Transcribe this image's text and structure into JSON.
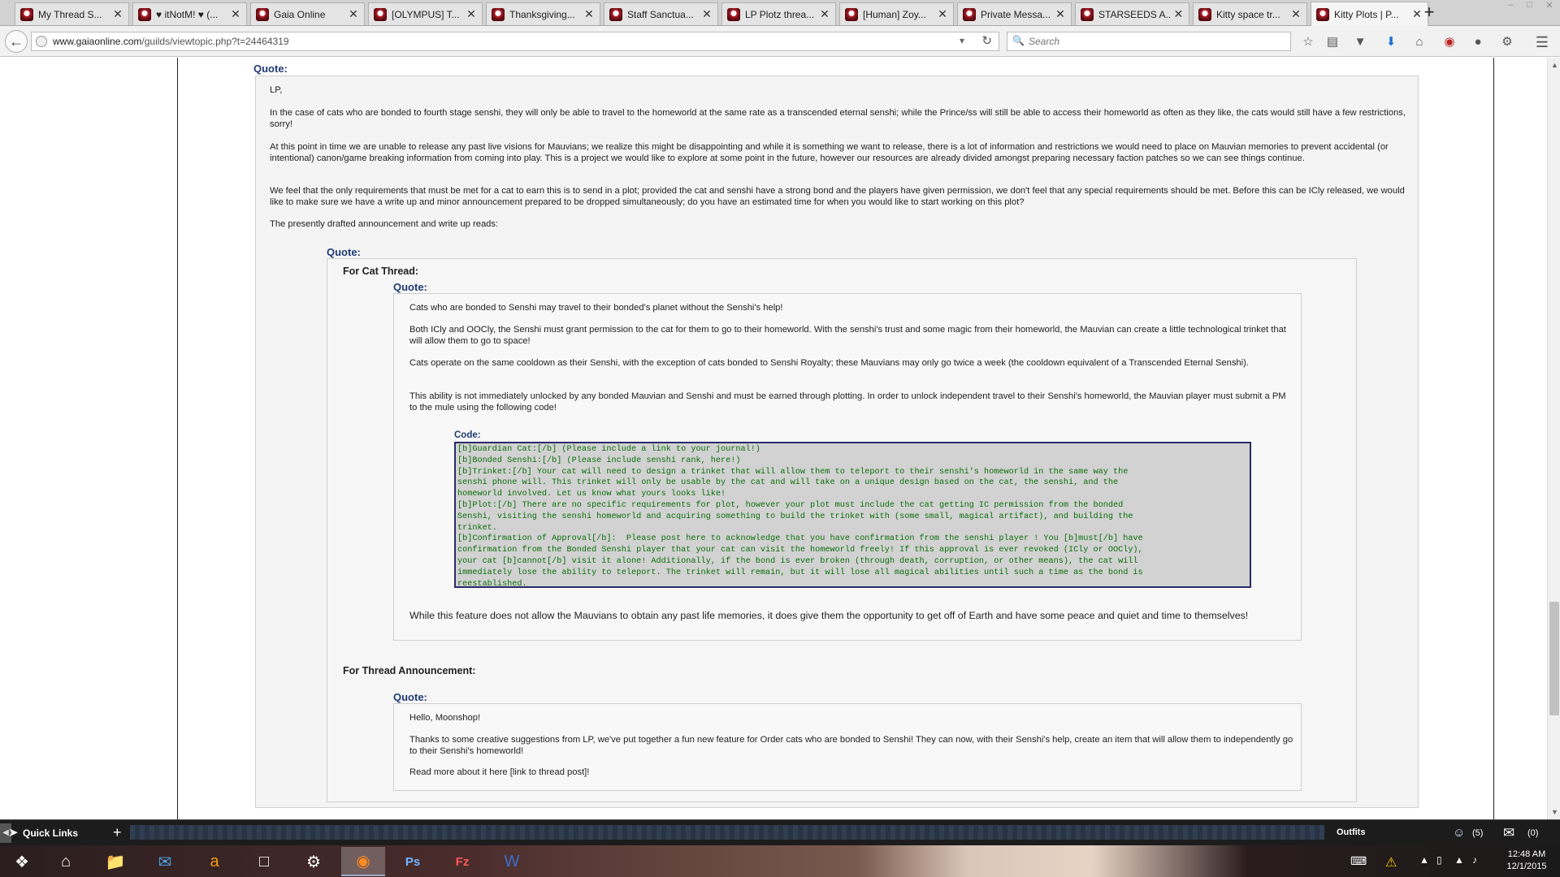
{
  "browser": {
    "tabs": [
      {
        "label": "My Thread S...",
        "active": false
      },
      {
        "label": "♥ itNotM! ♥ (...",
        "active": false
      },
      {
        "label": "Gaia Online",
        "active": false
      },
      {
        "label": "[OLYMPUS] T...",
        "active": false
      },
      {
        "label": "Thanksgiving...",
        "active": false
      },
      {
        "label": "Staff Sanctua...",
        "active": false
      },
      {
        "label": "LP Plotz threa...",
        "active": false
      },
      {
        "label": "[Human] Zoy...",
        "active": false
      },
      {
        "label": "Private Messa...",
        "active": false
      },
      {
        "label": "STARSEEDS A...",
        "active": false
      },
      {
        "label": "Kitty space tr...",
        "active": false
      },
      {
        "label": "Kitty Plots | P...",
        "active": true
      }
    ],
    "url_domain": "www.gaiaonline.com",
    "url_path": "/guilds/viewtopic.php?t=24464319",
    "search_placeholder": "Search"
  },
  "post": {
    "quote_label": "Quote:",
    "outer_paragraphs": [
      "LP,",
      "In the case of cats who are bonded to fourth stage senshi, they will only be able to travel to the homeworld at the same rate as a transcended eternal senshi; while the Prince/ss will still be able to access their homeworld as often as they like, the cats would still have a few restrictions, sorry!",
      "At this point in time we are unable to release any past live visions for Mauvians; we realize this might be disappointing and while it is something we want to release, there is a lot of information and restrictions we would need to place on Mauvian memories to prevent accidental (or intentional) canon/game breaking information from coming into play. This is a project we would like to explore at some point in the future, however our resources are already divided amongst preparing necessary faction patches so we can see things continue.",
      "We feel that the only requirements that must be met for a cat to earn this is to send in a plot; provided the cat and senshi have a strong bond and the players have given permission, we don't feel that any special requirements should be met. Before this can be ICly released, we would like to make sure we have a write up and minor announcement prepared to be dropped simultaneously; do you have an estimated time for when you would like to start working on this plot?",
      "The presently drafted announcement and write up reads:"
    ],
    "cat_thread_heading": "For Cat Thread:",
    "cat_thread_paragraphs": [
      "Cats who are bonded to Senshi may travel to their bonded's planet without the Senshi's help!",
      "Both ICly and OOCly, the Senshi must grant permission to the cat for them to go to their homeworld. With the senshi's trust and some magic from their homeworld, the Mauvian can create a little technological trinket that will allow them to go to space!",
      "Cats operate on the same cooldown as their Senshi, with the exception of cats bonded to Senshi Royalty; these Mauvians may only go twice a week (the cooldown equivalent of a Transcended Eternal Senshi).",
      "This ability is not immediately unlocked by any bonded Mauvian and Senshi and must be earned through plotting. In order to unlock independent travel to their Senshi's homeworld, the Mauvian player must submit a PM to the mule using the following code!"
    ],
    "code_label": "Code:",
    "code_lines": [
      "[b]Guardian Cat:[/b] (Please include a link to your journal!)",
      "[b]Bonded Senshi:[/b] (Please include senshi rank, here!)",
      "[b]Trinket:[/b] Your cat will need to design a trinket that will allow them to teleport to their senshi's homeworld in the same way the",
      "senshi phone will. This trinket will only be usable by the cat and will take on a unique design based on the cat, the senshi, and the",
      "homeworld involved. Let us know what yours looks like!",
      "[b]Plot:[/b] There are no specific requirements for plot, however your plot must include the cat getting IC permission from the bonded",
      "Senshi, visiting the senshi homeworld and acquiring something to build the trinket with (some small, magical artifact), and building the",
      "trinket.",
      "[b]Confirmation of Approval[/b]:  Please post here to acknowledge that you have confirmation from the senshi player ! You [b]must[/b] have",
      "confirmation from the Bonded Senshi player that your cat can visit the homeworld freely! If this approval is ever revoked (ICly or OOCly),",
      "your cat [b]cannot[/b] visit it alone! Additionally, if the bond is ever broken (through death, corruption, or other means), the cat will",
      "immediately lose the ability to teleport. The trinket will remain, but it will lose all magical abilities until such a time as the bond is",
      "reestablished."
    ],
    "cat_thread_closing": "While this feature does not allow the Mauvians to obtain any past life memories, it does give them the opportunity to get off of Earth and have some peace and quiet and time to themselves!",
    "announcement_heading": "For Thread Announcement:",
    "announcement_paragraphs": [
      "Hello, Moonshop!",
      "Thanks to some creative suggestions from LP, we've put together a fun new feature for Order cats who are bonded to Senshi! They can now, with their Senshi's help, create an item that will allow them to independently go to their Senshi's homeworld!",
      "Read more about it here [link to thread post]!"
    ]
  },
  "gaia_bar": {
    "quick_links": "Quick Links",
    "outfits": "Outfits",
    "friends_count": "(5)",
    "mail_count": "(0)"
  },
  "taskbar": {
    "apps": [
      "start-icon",
      "home-icon",
      "file-explorer-icon",
      "mail-icon",
      "amazon-icon",
      "document-icon",
      "network-icon",
      "firefox-icon",
      "photoshop-icon",
      "filezilla-icon",
      "word-icon"
    ],
    "ps_label": "Ps",
    "fz_label": "Fz",
    "time": "12:48 AM",
    "date": "12/1/2015"
  }
}
